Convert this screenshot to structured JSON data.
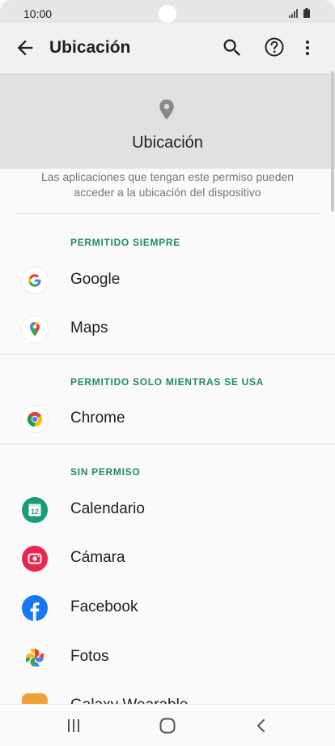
{
  "status_bar": {
    "time": "10:00",
    "icons": [
      "signal-icon",
      "battery-icon"
    ]
  },
  "app_bar": {
    "title": "Ubicación",
    "actions": [
      "back-arrow-icon",
      "search-icon",
      "help-icon",
      "more-vert-icon"
    ]
  },
  "hero": {
    "icon": "location-pin-icon",
    "title": "Ubicación"
  },
  "description": "Las aplicaciones que tengan este permiso pueden acceder a la ubicación del dispositivo",
  "sections": [
    {
      "header": "PERMITIDO SIEMPRE",
      "apps": [
        {
          "name": "Google"
        },
        {
          "name": "Maps"
        }
      ]
    },
    {
      "header": "PERMITIDO SOLO MIENTRAS SE USA",
      "apps": [
        {
          "name": "Chrome"
        }
      ]
    },
    {
      "header": "SIN PERMISO",
      "apps": [
        {
          "name": "Calendario",
          "icon_label": "12"
        },
        {
          "name": "Cámara"
        },
        {
          "name": "Facebook"
        },
        {
          "name": "Fotos"
        },
        {
          "name": "Galaxy Wearable"
        }
      ]
    }
  ],
  "colors": {
    "accent": "#208a6c",
    "app_bar_bg": "#f1f1f1",
    "hero_bg": "#e1e1e1"
  },
  "nav_bar": {
    "buttons": [
      "recents-icon",
      "home-icon",
      "back-icon"
    ]
  }
}
